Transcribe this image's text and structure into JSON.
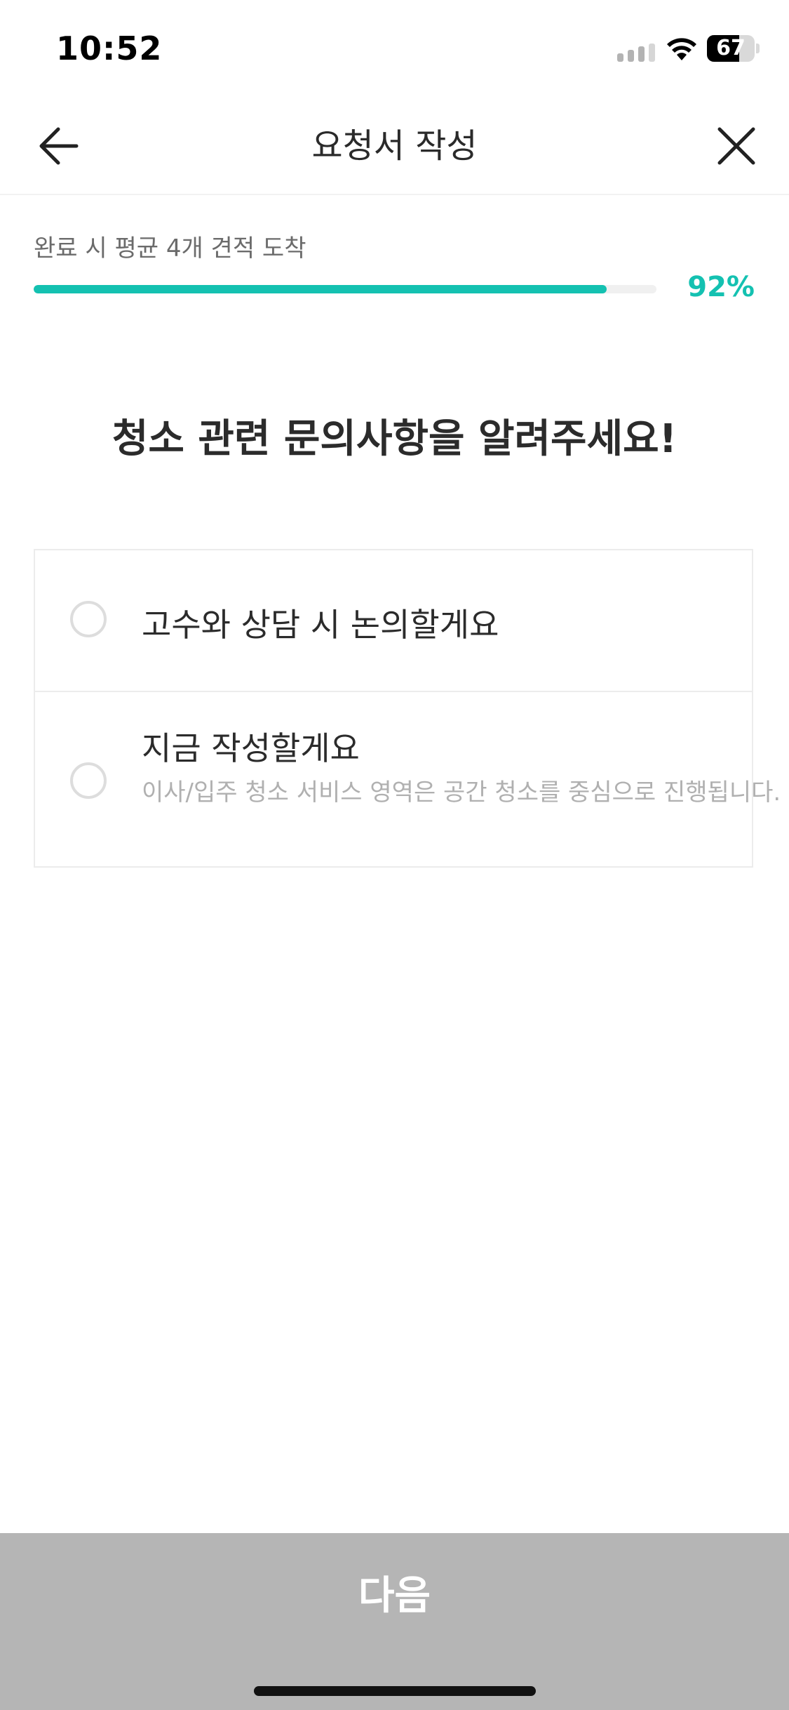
{
  "status_bar": {
    "time": "10:52",
    "battery_level": "67",
    "battery_fraction": 0.67
  },
  "nav": {
    "title": "요청서 작성",
    "back_icon": "arrow-left-icon",
    "close_icon": "close-icon"
  },
  "progress": {
    "caption": "완료 시 평균 4개 견적 도착",
    "percent_label": "92%",
    "value": 0.92,
    "color": "#14c1b1"
  },
  "question": {
    "title": "청소 관련 문의사항을 알려주세요!"
  },
  "options": [
    {
      "label": "고수와 상담 시 논의할게요",
      "description": ""
    },
    {
      "label": "지금 작성할게요",
      "description": "이사/입주 청소 서비스 영역은 공간 청소를 중심으로 진행됩니다."
    }
  ],
  "footer": {
    "next_label": "다음",
    "button_color": "#b5b5b5"
  }
}
